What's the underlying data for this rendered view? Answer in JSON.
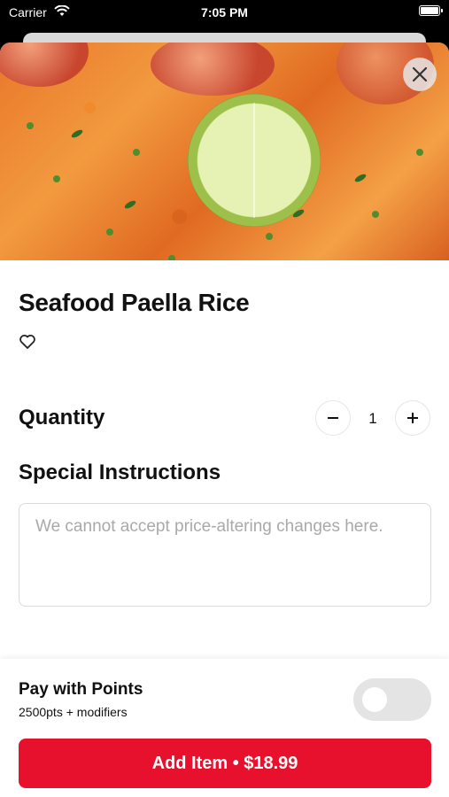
{
  "status_bar": {
    "carrier": "Carrier",
    "time": "7:05 PM"
  },
  "item": {
    "title": "Seafood Paella Rice",
    "image_icon": "paella-photo"
  },
  "quantity": {
    "label": "Quantity",
    "value": "1"
  },
  "special_instructions": {
    "label": "Special Instructions",
    "placeholder": "We cannot accept price-altering changes here.",
    "value": ""
  },
  "points": {
    "label": "Pay with Points",
    "sub": "2500pts + modifiers",
    "enabled": false
  },
  "add_button": {
    "label": "Add Item • $18.99"
  },
  "colors": {
    "accent": "#e8112d",
    "toggle_off": "#e4e4e4"
  }
}
